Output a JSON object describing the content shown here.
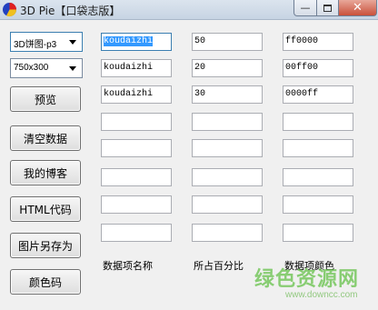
{
  "window": {
    "title": "3D Pie【口袋志版】",
    "minimize_glyph": "—",
    "close_glyph": "✕"
  },
  "controls": {
    "chart_type": "3D饼图-p3",
    "size": "750x300"
  },
  "buttons": [
    "预览",
    "清空数据",
    "我的博客",
    "HTML代码",
    "图片另存为",
    "颜色码"
  ],
  "rows": [
    {
      "name": "koudaizhi",
      "percent": "50",
      "color": "ff0000"
    },
    {
      "name": "koudaizhi",
      "percent": "20",
      "color": "00ff00"
    },
    {
      "name": "koudaizhi",
      "percent": "30",
      "color": "0000ff"
    },
    {
      "name": "",
      "percent": "",
      "color": ""
    },
    {
      "name": "",
      "percent": "",
      "color": ""
    },
    {
      "name": "",
      "percent": "",
      "color": ""
    },
    {
      "name": "",
      "percent": "",
      "color": ""
    },
    {
      "name": "",
      "percent": "",
      "color": ""
    }
  ],
  "captions": {
    "name": "数据项名称",
    "percent": "所占百分比",
    "color": "数据项颜色"
  },
  "watermark": {
    "main": "绿色资源网",
    "url": "www.downcc.com"
  },
  "colors": {
    "selection": "#3399ff",
    "watermark": "#66c24a"
  }
}
